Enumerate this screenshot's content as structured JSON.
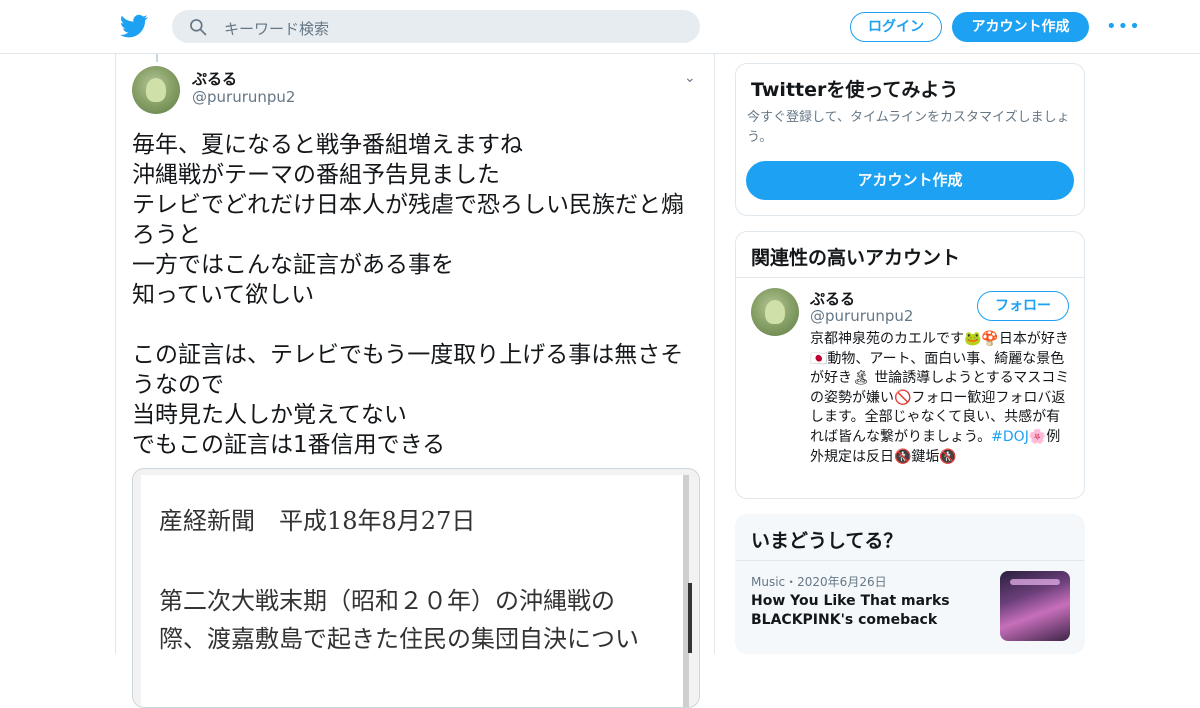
{
  "header": {
    "search_placeholder": "キーワード検索",
    "login_label": "ログイン",
    "signup_label": "アカウント作成"
  },
  "tweet": {
    "name": "ぷるる",
    "handle": "@pururunpu2",
    "text": "毎年、夏になると戦争番組増えますね\n沖縄戦がテーマの番組予告見ました\nテレビでどれだけ日本人が残虐で恐ろしい民族だと煽ろうと\n一方ではこんな証言がある事を\n知っていて欲しい\n\nこの証言は、テレビでもう一度取り上げる事は無さそうなので\n当時見た人しか覚えてない\nでもこの証言は1番信用できる",
    "image_text": {
      "line1": "産経新聞　平成18年8月27日",
      "line2": "第二次大戦末期（昭和２０年）の沖縄戦の",
      "line3": "際、渡嘉敷島で起きた住民の集団自決につい"
    }
  },
  "sidebar": {
    "try": {
      "title": "Twitterを使ってみよう",
      "subtitle": "今すぐ登録して、タイムラインをカスタマイズしましょう。",
      "cta": "アカウント作成"
    },
    "related": {
      "title": "関連性の高いアカウント",
      "name": "ぷるる",
      "handle": "@pururunpu2",
      "follow_label": "フォロー",
      "bio_before": "京都神泉苑のカエルです🐸🍄日本が好き🇯🇵動物、アート、面白い事、綺麗な景色が好き🏝 世論誘導しようとするマスコミの姿勢が嫌い🚫フォロー歓迎フォロバ返します。全部じゃなくて良い、共感が有れば皆んな繋がりましょう。",
      "bio_tag": "#DOJ",
      "bio_after": "🌸例外規定は反日🚷鍵垢🚷"
    },
    "trends": {
      "title": "いまどうしてる？",
      "meta": "Music・2020年6月26日",
      "headline": "How You Like That marks BLACKPINK's comeback"
    }
  },
  "colors": {
    "accent": "#1da1f2",
    "muted": "#657786",
    "border": "#e1e8ed"
  }
}
